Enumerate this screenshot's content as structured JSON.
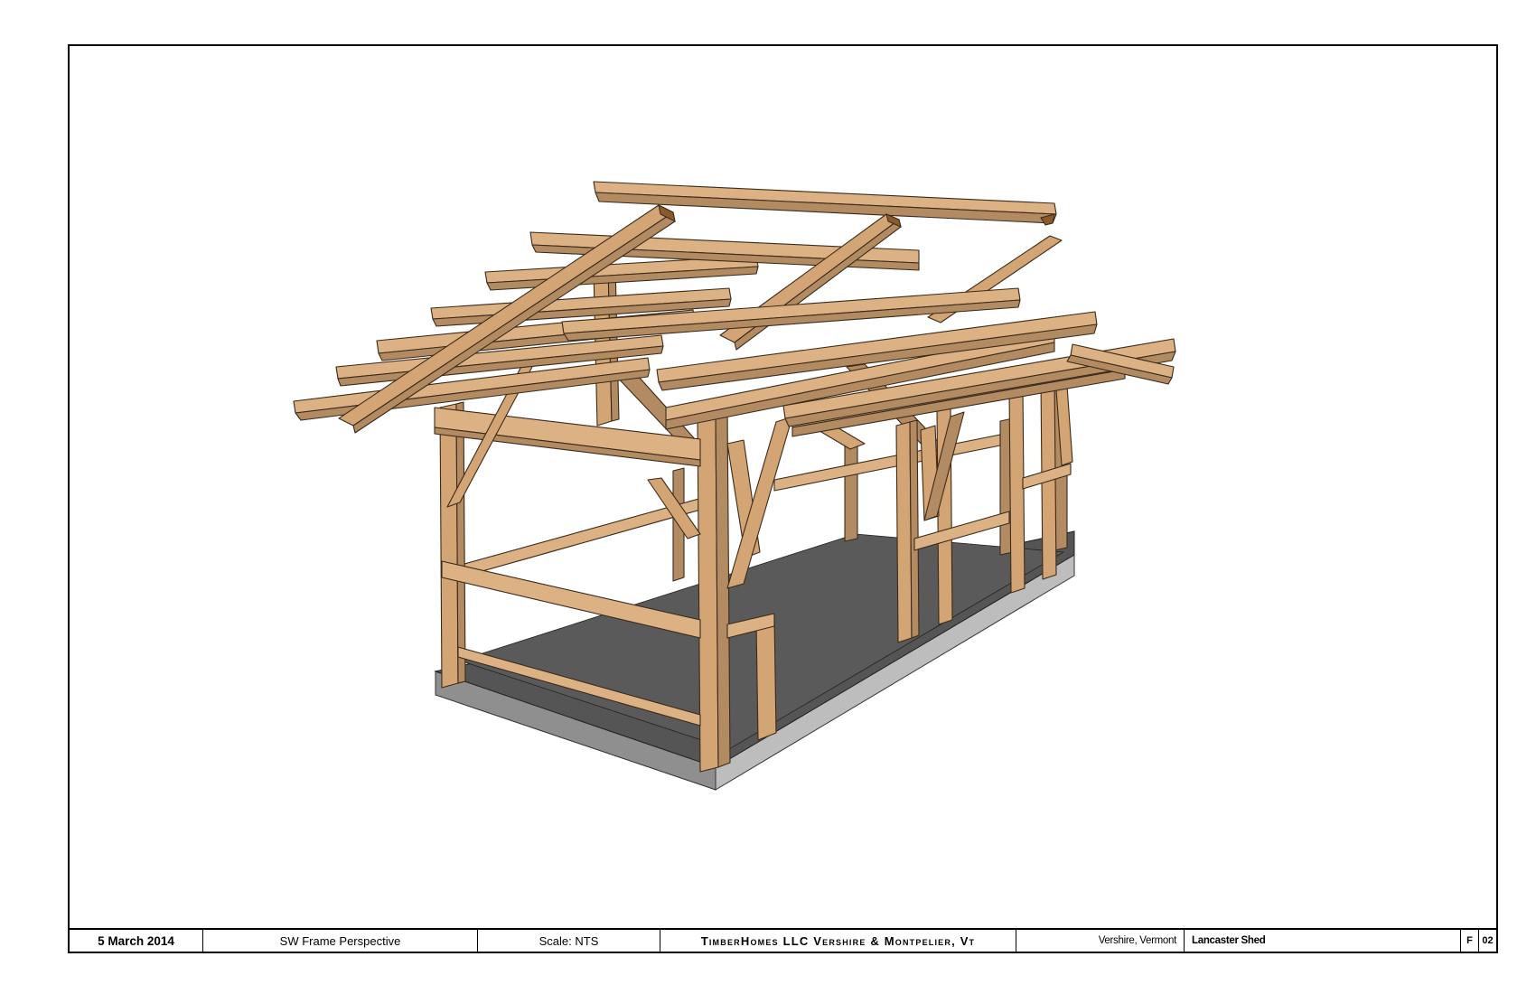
{
  "title_block": {
    "date": "5 March 2014",
    "view": "SW Frame Perspective",
    "scale": "Scale: NTS",
    "firm": "TimberHomes LLC Vershire & Montpelier, Vt",
    "location": "Vershire, Vermont",
    "project": "Lancaster Shed",
    "sheet_letter": "F",
    "sheet_number": "02"
  },
  "colors": {
    "timber": "#d4a574",
    "timber_dark": "#a8845e",
    "timber_end": "#8b5a2b",
    "floor": "#555555",
    "foundation": "#9a9a9a",
    "foundation_side": "#bdbdbd"
  }
}
